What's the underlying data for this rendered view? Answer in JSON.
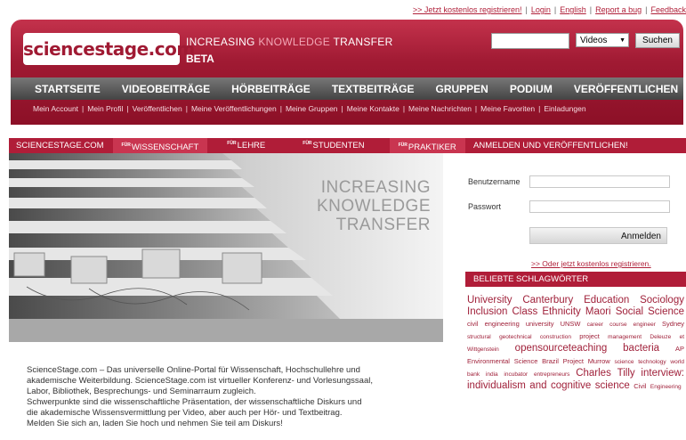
{
  "top_links": [
    ">> Jetzt kostenlos registrieren!",
    "Login",
    "English",
    "Report a bug",
    "Feedback"
  ],
  "header": {
    "logo": "sciencestage.com",
    "tagline_part1": "INCREASING",
    "tagline_part2": "KNOWLEDGE",
    "tagline_part3": "TRANSFER",
    "beta": "BETA",
    "search_value": "",
    "search_select": "Videos",
    "search_button": "Suchen"
  },
  "nav": [
    "STARTSEITE",
    "VIDEOBEITRÄGE",
    "HÖRBEITRÄGE",
    "TEXTBEITRÄGE",
    "GRUPPEN",
    "PODIUM",
    "VERÖFFENTLICHEN"
  ],
  "subnav": [
    "Mein Account",
    "Mein Profil",
    "Veröffentlichen",
    "Meine Veröffentlichungen",
    "Meine Gruppen",
    "Meine Kontakte",
    "Meine Nachrichten",
    "Meine Favoriten",
    "Einladungen"
  ],
  "tabs": {
    "site": "SCIENCESTAGE.COM",
    "prefix": "FÜR",
    "items": [
      "WISSENSCHAFT",
      "LEHRE",
      "STUDENTEN",
      "PRAKTIKER"
    ]
  },
  "hero": {
    "line1": "INCREASING",
    "line2": "KNOWLEDGE",
    "line3": "TRANSFER"
  },
  "description": [
    "ScienceStage.com – Das universelle Online-Portal für Wissenschaft, Hochschullehre und",
    "akademische Weiterbildung. ScienceStage.com ist virtueller Konferenz- und Vorlesungssaal,",
    "Labor, Bibliothek, Besprechungs- und Seminarraum zugleich.",
    "Schwerpunkte sind die wissenschaftliche Präsentation, der wissenschaftliche Diskurs und",
    "die akademische Wissensvermittlung per Video, aber auch per Hör- und Textbeitrag.",
    "Melden Sie sich an, laden Sie hoch und nehmen Sie teil am Diskurs!"
  ],
  "login": {
    "title": "ANMELDEN UND VERÖFFENTLICHEN!",
    "username_label": "Benutzername",
    "password_label": "Passwort",
    "username_value": "",
    "password_value": "",
    "button": "Anmelden",
    "register_link": ">> Oder jetzt kostenlos registrieren."
  },
  "tags": {
    "title": "BELIEBTE SCHLAGWÖRTER",
    "items": [
      {
        "t": "University",
        "s": "s1"
      },
      {
        "t": "Canterbury",
        "s": "s1"
      },
      {
        "t": "Education",
        "s": "s1"
      },
      {
        "t": "Sociology",
        "s": "s1"
      },
      {
        "t": "Inclusion",
        "s": "s1"
      },
      {
        "t": "Class",
        "s": "s1"
      },
      {
        "t": "Ethnicity",
        "s": "s1"
      },
      {
        "t": "Maori",
        "s": "s1"
      },
      {
        "t": "Social",
        "s": "s1"
      },
      {
        "t": "Science",
        "s": "s1"
      },
      {
        "t": "civil",
        "s": "s2"
      },
      {
        "t": "engineering",
        "s": "s2"
      },
      {
        "t": "university",
        "s": "s2"
      },
      {
        "t": "UNSW",
        "s": "s2"
      },
      {
        "t": "career",
        "s": "s3"
      },
      {
        "t": "course",
        "s": "s3"
      },
      {
        "t": "engineer",
        "s": "s3"
      },
      {
        "t": "Sydney",
        "s": "s2"
      },
      {
        "t": "structural",
        "s": "s3"
      },
      {
        "t": "geotechnical",
        "s": "s3"
      },
      {
        "t": "construction",
        "s": "s3"
      },
      {
        "t": "project",
        "s": "s2"
      },
      {
        "t": "management",
        "s": "s3"
      },
      {
        "t": "Deleuze",
        "s": "s3"
      },
      {
        "t": "et",
        "s": "s3"
      },
      {
        "t": "Wittgenstein",
        "s": "s3"
      },
      {
        "t": "opensourceteaching",
        "s": "s1"
      },
      {
        "t": "bacteria",
        "s": "s1"
      },
      {
        "t": "AP",
        "s": "s2"
      },
      {
        "t": "Environmental",
        "s": "s2"
      },
      {
        "t": "Science",
        "s": "s2"
      },
      {
        "t": "Brazil",
        "s": "s2"
      },
      {
        "t": "Project",
        "s": "s2"
      },
      {
        "t": "Murrow",
        "s": "s2"
      },
      {
        "t": "science",
        "s": "s3"
      },
      {
        "t": "technology",
        "s": "s3"
      },
      {
        "t": "world",
        "s": "s3"
      },
      {
        "t": "bank",
        "s": "s3"
      },
      {
        "t": "india",
        "s": "s3"
      },
      {
        "t": "incubator",
        "s": "s3"
      },
      {
        "t": "entrepreneurs",
        "s": "s3"
      },
      {
        "t": "Charles",
        "s": "s1"
      },
      {
        "t": "Tilly",
        "s": "s1"
      },
      {
        "t": "interview:",
        "s": "s1"
      },
      {
        "t": "individualism",
        "s": "s1"
      },
      {
        "t": "and",
        "s": "s1"
      },
      {
        "t": "cognitive",
        "s": "s1"
      },
      {
        "t": "science",
        "s": "s1"
      },
      {
        "t": "Civil",
        "s": "s2"
      },
      {
        "t": "Engineering",
        "s": "s3"
      }
    ]
  }
}
